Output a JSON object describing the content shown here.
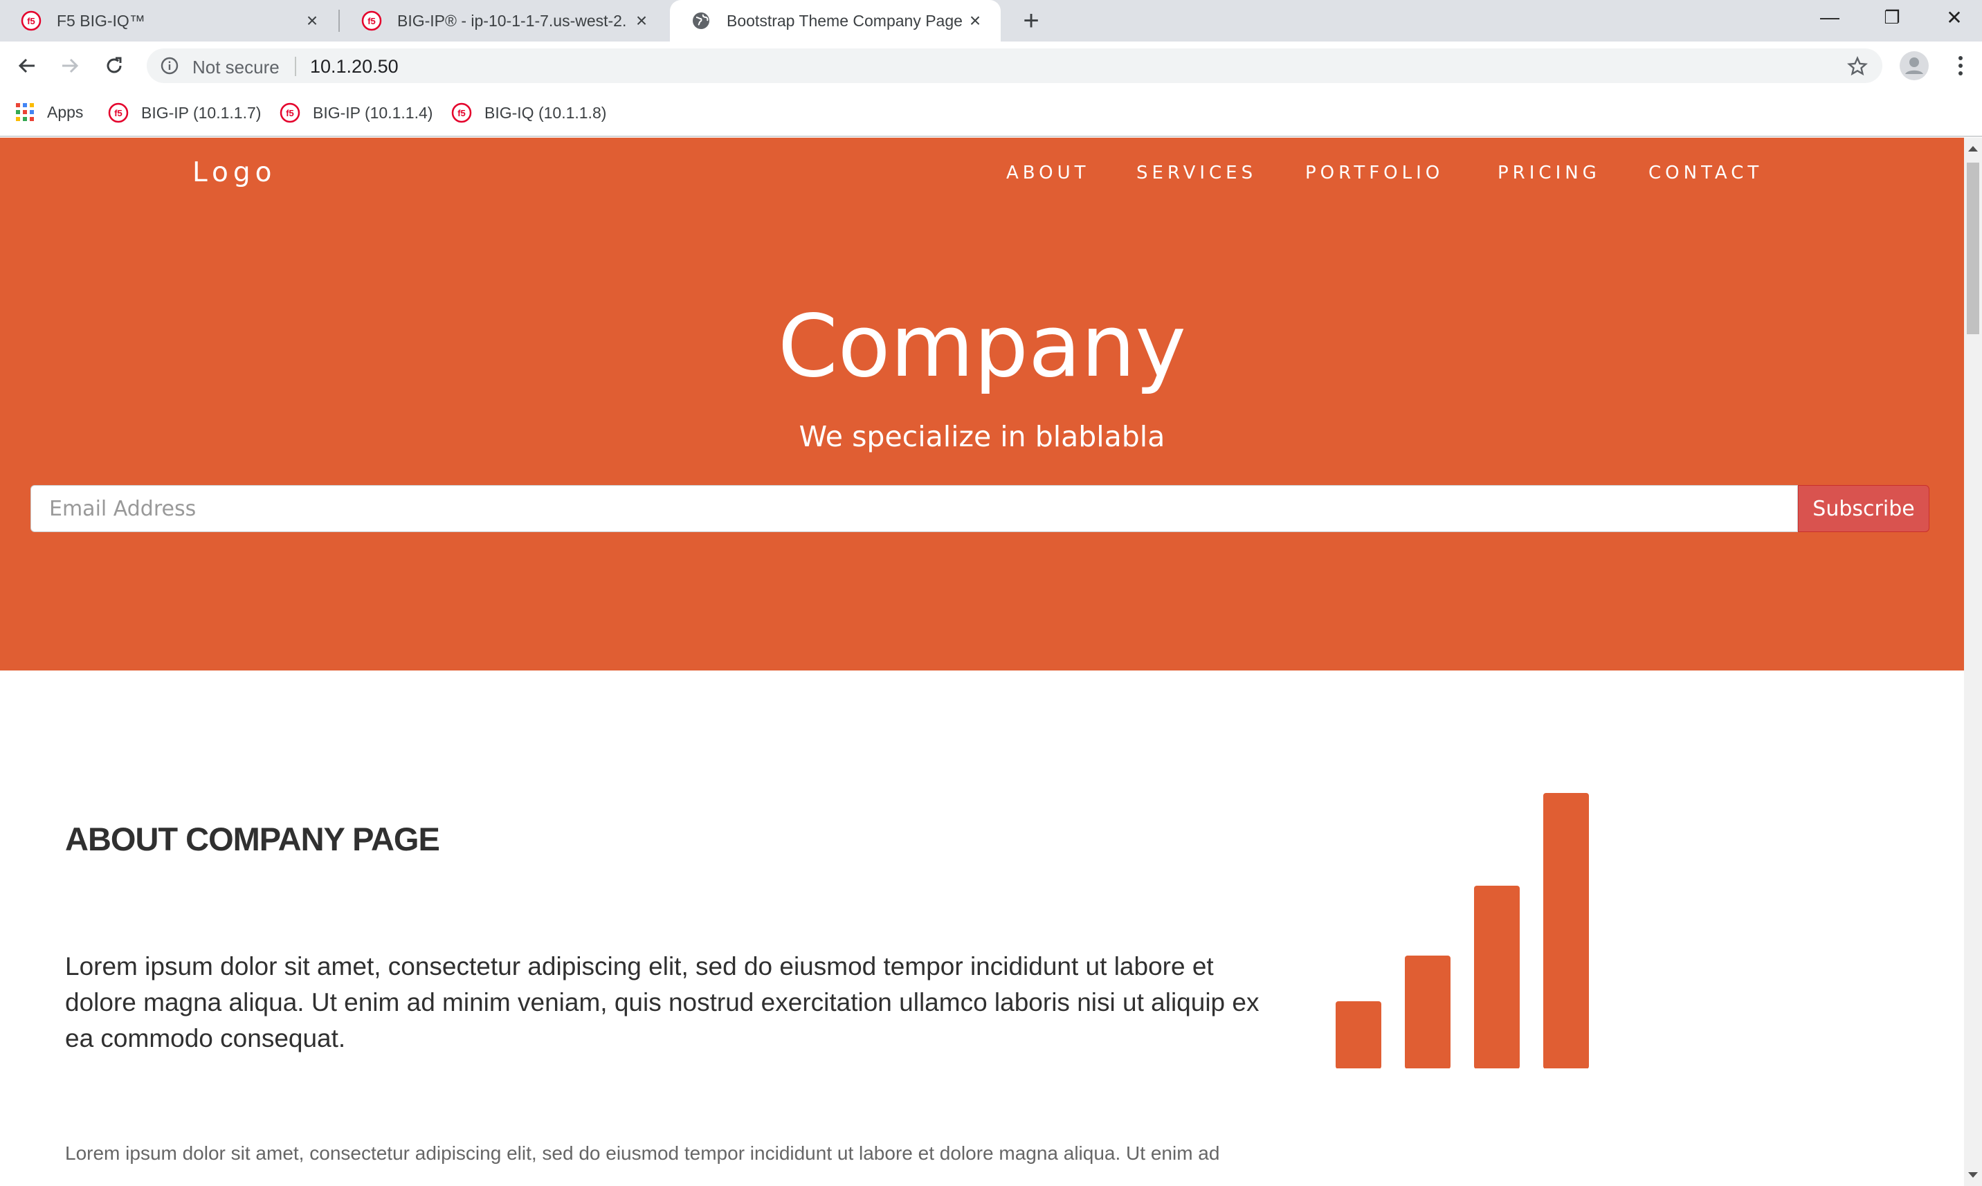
{
  "browser": {
    "tabs": [
      {
        "title": "F5 BIG-IQ™",
        "icon": "f5-logo-icon",
        "active": false
      },
      {
        "title": "BIG-IP® - ip-10-1-1-7.us-west-2.",
        "icon": "f5-logo-icon",
        "active": false
      },
      {
        "title": "Bootstrap Theme Company Page",
        "icon": "globe-icon",
        "active": true
      }
    ],
    "new_tab_label": "+",
    "window_controls": {
      "minimize": "—",
      "restore": "❐",
      "close": "✕"
    },
    "address_bar": {
      "security_label": "Not secure",
      "url": "10.1.20.50"
    },
    "bookmarks": [
      {
        "label": "Apps",
        "icon": "apps-grid-icon"
      },
      {
        "label": "BIG-IP (10.1.1.7)",
        "icon": "f5-logo-icon"
      },
      {
        "label": "BIG-IP (10.1.1.4)",
        "icon": "f5-logo-icon"
      },
      {
        "label": "BIG-IQ (10.1.1.8)",
        "icon": "f5-logo-icon"
      }
    ]
  },
  "page": {
    "logo": "Logo",
    "nav": [
      "ABOUT",
      "SERVICES",
      "PORTFOLIO",
      "PRICING",
      "CONTACT"
    ],
    "hero": {
      "title": "Company",
      "subtitle": "We specialize in blablabla",
      "email_placeholder": "Email Address",
      "subscribe_label": "Subscribe"
    },
    "about": {
      "heading": "ABOUT COMPANY PAGE",
      "lead": "Lorem ipsum dolor sit amet, consectetur adipiscing elit, sed do eiusmod tempor incididunt ut labore et dolore magna aliqua. Ut enim ad minim veniam, quis nostrud exercitation ullamco laboris nisi ut aliquip ex ea commodo consequat.",
      "body": "Lorem ipsum dolor sit amet, consectetur adipiscing elit, sed do eiusmod tempor incididunt ut labore et dolore magna aliqua. Ut enim ad",
      "graphic_icon": "signal-bars-icon"
    }
  },
  "colors": {
    "brand": "#e05e33",
    "subscribe": "#d9534f",
    "tabstrip": "#dee1e6",
    "text_dark": "#303030"
  }
}
